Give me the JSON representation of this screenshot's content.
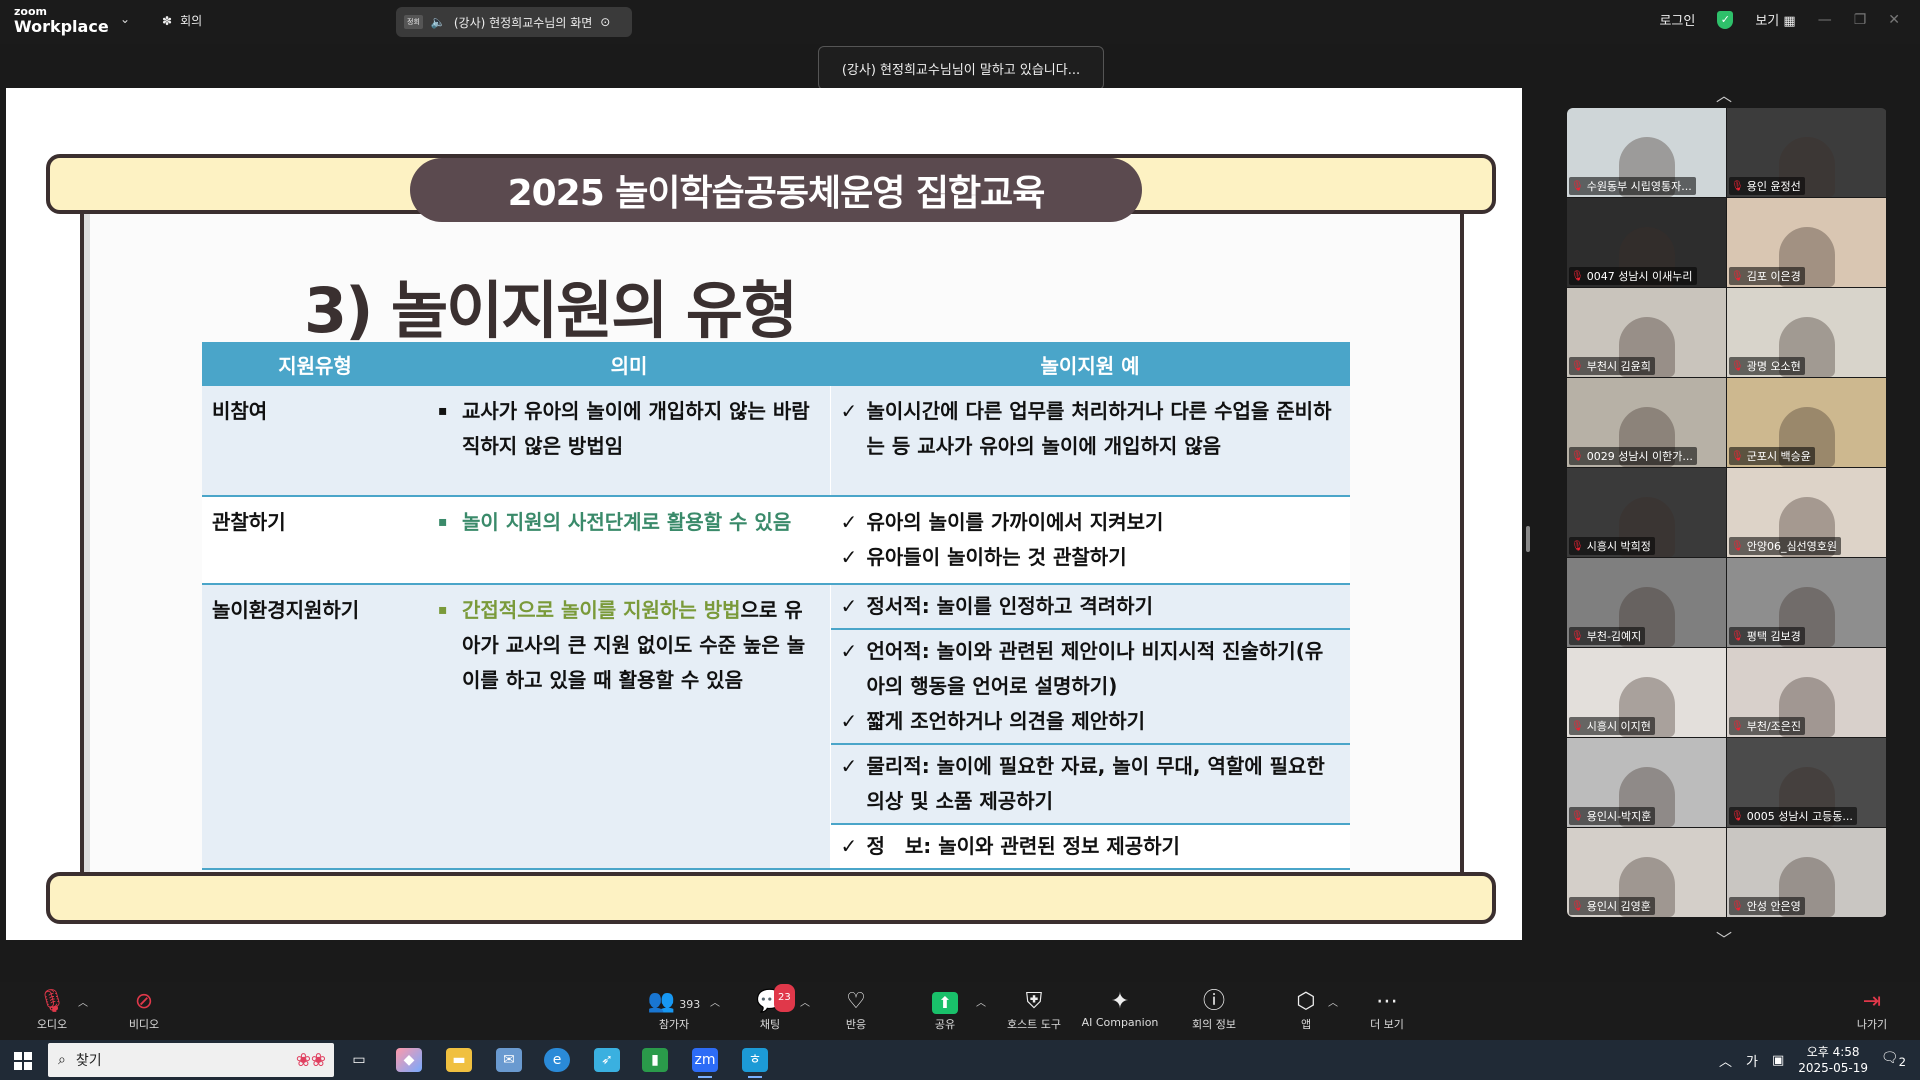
{
  "topbar": {
    "logo_line1": "zoom",
    "logo_line2": "Workplace",
    "meeting_label": "회의",
    "share_tag": "정회",
    "share_title": "(강사) 현정희교수님의 화면",
    "login": "로그인",
    "view": "보기"
  },
  "toast": "(강사) 현정희교수님님이 말하고 있습니다...",
  "slide": {
    "banner": "2025 놀이학습공동체운영 집합교육",
    "heading": "3) 놀이지원의 유형",
    "table": {
      "headers": [
        "지원유형",
        "의미",
        "놀이지원 예"
      ],
      "rows": [
        {
          "type": "비참여",
          "meaning": "교사가 유아의 놀이에 개입하지 않는 바람직하지 않은 방법임",
          "examples": [
            "놀이시간에 다른 업무를 처리하거나 다른 수업을 준비하는 등 교사가 유아의 놀이에 개입하지 않음"
          ]
        },
        {
          "type": "관찰하기",
          "meaning": "놀이 지원의 사전단계로 활용할 수 있음",
          "examples": [
            "유아의 놀이를 가까이에서 지켜보기",
            "유아들이 놀이하는 것 관찰하기"
          ]
        },
        {
          "type": "놀이환경지원하기",
          "meaning_highlight": "간접적으로 놀이를 지원하는 방법",
          "meaning_rest": "으로 유아가 교사의 큰 지원 없이도 수준 높은 놀이를 하고 있을 때 활용할 수 있음",
          "examples": [
            "정서적: 놀이를 인정하고 격려하기",
            "언어적: 놀이와 관련된 제안이나 비지시적 진술하기(유아의 행동을 언어로 설명하기)",
            "짧게 조언하거나 의견을 제안하기",
            "물리적: 놀이에 필요한 자료, 놀이 무대, 역할에 필요한 의상 및 소품 제공하기",
            "정　보: 놀이와 관련된 정보 제공하기"
          ]
        }
      ]
    }
  },
  "participants": [
    {
      "name": "수원동부 시립영통자...",
      "bg": "#cfd6d8"
    },
    {
      "name": "용인 윤정선",
      "bg": "#3c3c3c"
    },
    {
      "name": "0047 성남시 이새누리",
      "bg": "#2d2d2d"
    },
    {
      "name": "김포 이은경",
      "bg": "#d9c6b2"
    },
    {
      "name": "부천시 김윤희",
      "bg": "#c9c4bc"
    },
    {
      "name": "광명 오소현",
      "bg": "#d8d4cb"
    },
    {
      "name": "0029 성남시 이한가...",
      "bg": "#b7b1a6"
    },
    {
      "name": "군포시 백승윤",
      "bg": "#cdb88f"
    },
    {
      "name": "시흥시 박희정",
      "bg": "#3a3a3a"
    },
    {
      "name": "안양06_심선영호원",
      "bg": "#ddd3c8"
    },
    {
      "name": "부천-김예지",
      "bg": "#7f7f7f"
    },
    {
      "name": "평택 김보경",
      "bg": "#8e8e8e"
    },
    {
      "name": "시흥시 이지현",
      "bg": "#e3dfdb"
    },
    {
      "name": "부천/조은진",
      "bg": "#d8d0cb"
    },
    {
      "name": "용인시-박지훈",
      "bg": "#bcbcbc"
    },
    {
      "name": "0005 성남시 고등동...",
      "bg": "#4b4b4b"
    },
    {
      "name": "용인시 김영훈",
      "bg": "#d4cfc9"
    },
    {
      "name": "안성 안은영",
      "bg": "#c9c6c2"
    }
  ],
  "toolbar": {
    "audio": "오디오",
    "video": "비디오",
    "participants": "참가자",
    "participant_count": "393",
    "chat": "채팅",
    "chat_badge": "23",
    "reactions": "반응",
    "share": "공유",
    "host_tools": "호스트 도구",
    "ai": "AI Companion",
    "meeting_info": "회의 정보",
    "apps": "앱",
    "more": "더 보기",
    "leave": "나가기"
  },
  "taskbar": {
    "search": "찾기",
    "ime": "가",
    "time": "오후 4:58",
    "date": "2025-05-19",
    "notif_count": "2"
  }
}
